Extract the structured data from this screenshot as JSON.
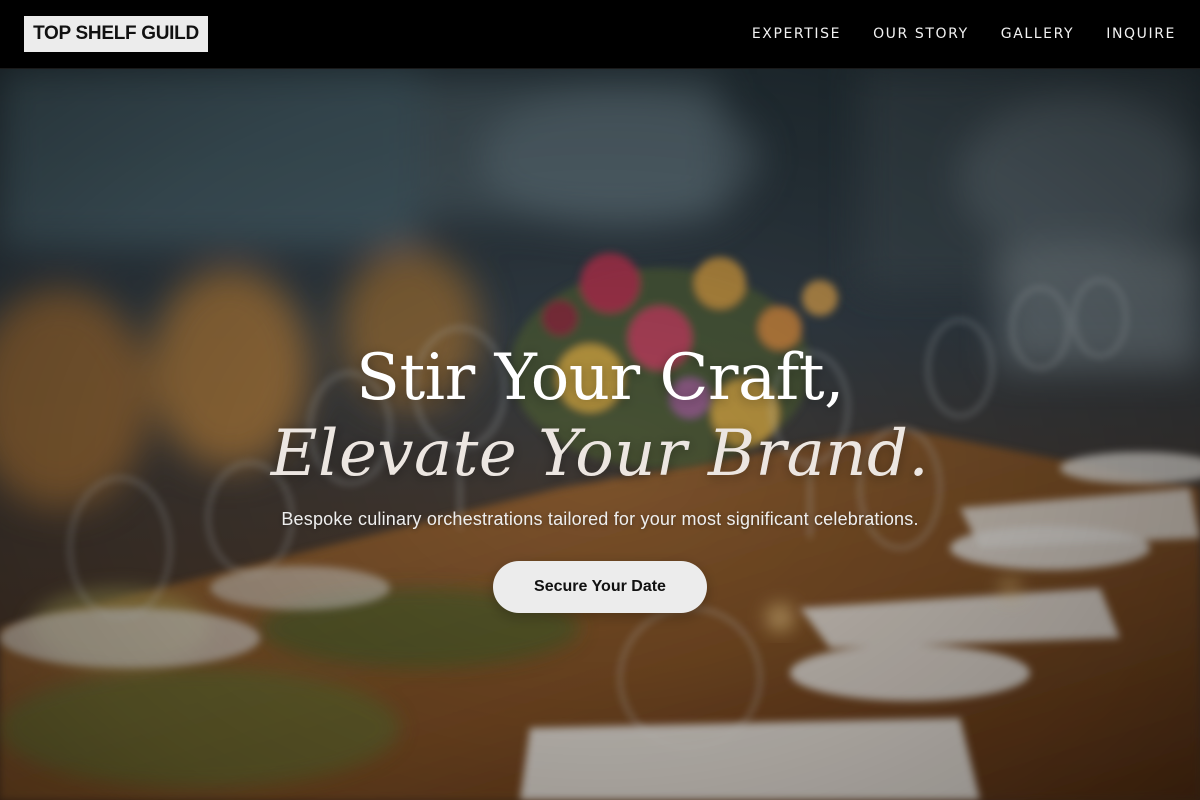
{
  "brand": {
    "logo_text": "TOP SHELF GUILD"
  },
  "nav": {
    "items": [
      {
        "label": "EXPERTISE"
      },
      {
        "label": "OUR STORY"
      },
      {
        "label": "GALLERY"
      },
      {
        "label": "INQUIRE"
      }
    ]
  },
  "hero": {
    "headline_line1": "Stir Your Craft,",
    "headline_line2": "Elevate Your Brand.",
    "subtext": "Bespoke culinary orchestrations tailored for your most significant celebrations.",
    "cta_label": "Secure Your Date",
    "image_alt": "banquet-table-photo"
  },
  "colors": {
    "nav_bg": "#000000",
    "logo_bg": "#ececec",
    "cta_bg": "#ececec",
    "headline": "#ffffff"
  }
}
